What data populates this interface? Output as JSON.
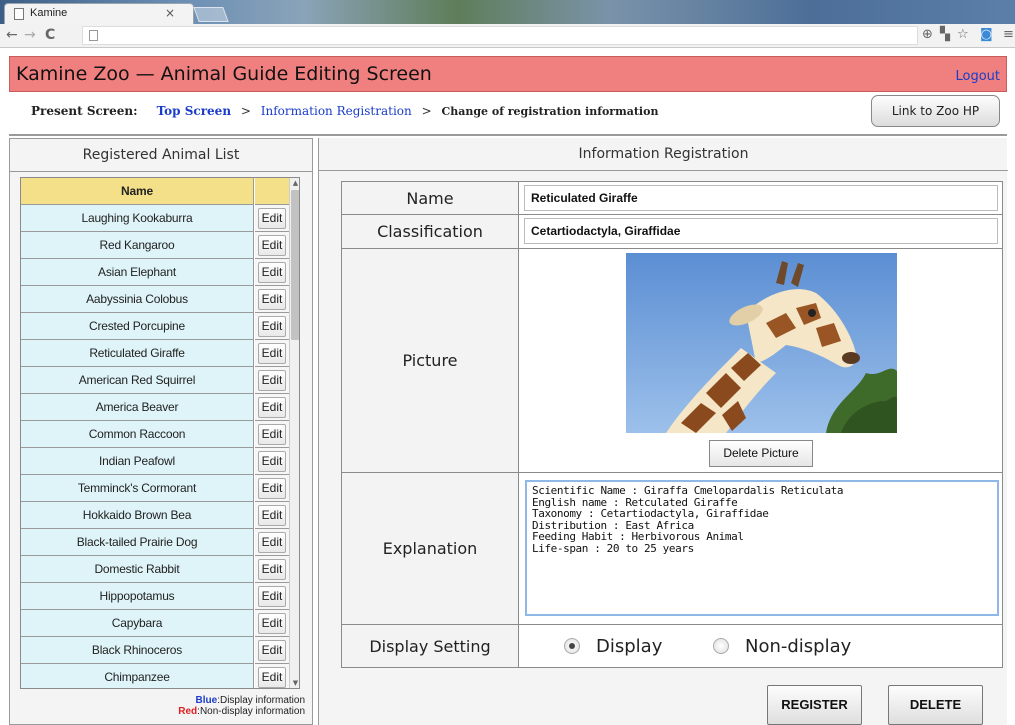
{
  "browser": {
    "tab_title": "Kamine",
    "tab_close": "×",
    "nav_back": "←",
    "nav_forward": "→",
    "nav_reload": "C",
    "icons": [
      "page-icon",
      "zoom-icon",
      "translate-icon",
      "star-icon",
      "camera-icon",
      "menu-icon"
    ]
  },
  "header": {
    "title": "Kamine Zoo — Animal Guide Editing Screen",
    "logout": "Logout",
    "color": "#f08080"
  },
  "breadcrumb": {
    "label": "Present Screen:",
    "top": "Top Screen",
    "sep1": ">",
    "info": "Information Registration",
    "sep2": ">",
    "current": "Change of registration information"
  },
  "zoo_link": "Link to Zoo HP",
  "left": {
    "title": "Registered Animal List",
    "column_name": "Name",
    "edit_label": "Edit",
    "animals": [
      "Laughing Kookaburra",
      "Red Kangaroo",
      "Asian Elephant",
      "Aabyssinia Colobus",
      "Crested Porcupine",
      "Reticulated Giraffe",
      "American Red Squirrel",
      "America Beaver",
      "Common Raccoon",
      "Indian Peafowl",
      "Temminck's Cormorant",
      "Hokkaido Brown Bea",
      "Black-tailed Prairie Dog",
      "Domestic Rabbit",
      "Hippopotamus",
      "Capybara",
      "Black Rhinoceros",
      "Chimpanzee"
    ],
    "legend_blue_key": "Blue",
    "legend_blue_text": ":Display information",
    "legend_red_key": "Red",
    "legend_red_text": ":Non-display information"
  },
  "right": {
    "title": "Information Registration",
    "labels": {
      "name": "Name",
      "classification": "Classification",
      "picture": "Picture",
      "explanation": "Explanation",
      "display": "Display Setting"
    },
    "name_value": "Reticulated Giraffe",
    "classification_value": "Cetartiodactyla, Giraffidae",
    "delete_picture": "Delete Picture",
    "explanation_value": "Scientific Name : Giraffa Cmelopardalis Reticulata\nEnglish name : Retculated Giraffe\nTaxonomy : Cetartiodactyla, Giraffidae\nDistribution : East Africa\nFeeding Habit : Herbivorous Animal\nLife-span : 20 to 25 years",
    "display_option": "Display",
    "nondisplay_option": "Non-display",
    "display_selected": "Display",
    "register": "REGISTER",
    "delete": "DELETE"
  }
}
